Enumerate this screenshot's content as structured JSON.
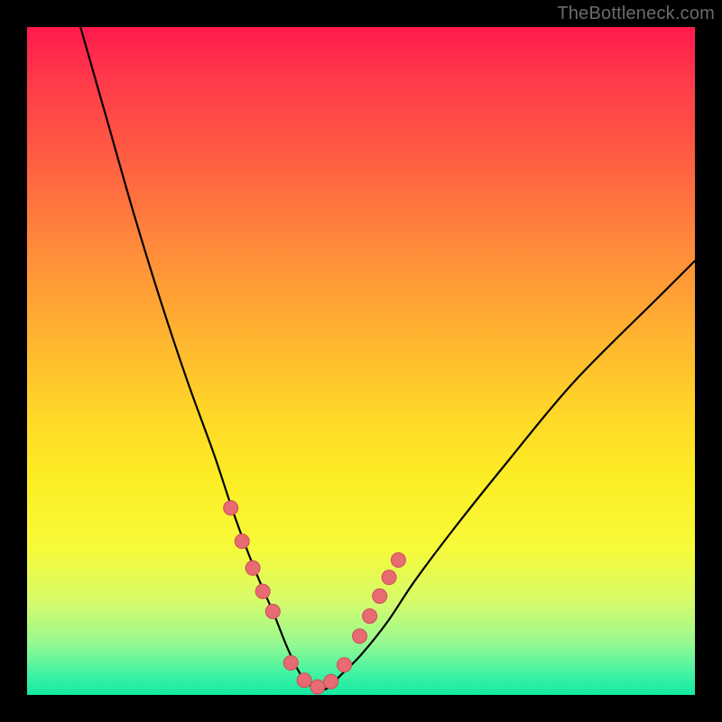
{
  "watermark": "TheBottleneck.com",
  "colors": {
    "frame": "#000000",
    "curve": "#000000",
    "marker_fill": "#e86a73",
    "marker_stroke": "#c84f59",
    "gradient_stops": [
      "#ff1a4d",
      "#ff3a4a",
      "#ff5843",
      "#ff7a3e",
      "#ff9a36",
      "#ffb92f",
      "#ffd728",
      "#fcee25",
      "#f7fa3a",
      "#d6fb6a",
      "#9af98f",
      "#3ef3a4",
      "#12e9a1"
    ]
  },
  "chart_data": {
    "type": "line",
    "title": "",
    "xlabel": "",
    "ylabel": "",
    "xlim": [
      0,
      100
    ],
    "ylim": [
      0,
      100
    ],
    "note": "V-shaped bottleneck curve; y≈mismatch %, minimum near x≈43. Axis values estimated from pixel geometry (no tick labels in source).",
    "series": [
      {
        "name": "bottleneck-curve",
        "x": [
          8,
          12,
          16,
          20,
          24,
          28,
          31,
          34,
          37,
          39,
          41,
          43,
          45,
          47,
          50,
          54,
          58,
          64,
          72,
          82,
          95,
          100
        ],
        "y": [
          100,
          86,
          72,
          59,
          47,
          36,
          27,
          19,
          12,
          7,
          3,
          1,
          1,
          3,
          6,
          11,
          17,
          25,
          35,
          47,
          60,
          65
        ]
      }
    ],
    "markers": {
      "name": "highlight-dots",
      "x": [
        30.5,
        32.2,
        33.8,
        35.3,
        36.8,
        39.5,
        41.5,
        43.5,
        45.5,
        47.5,
        49.8,
        51.3,
        52.8,
        54.2,
        55.6
      ],
      "y": [
        28,
        23,
        19,
        15.5,
        12.5,
        4.8,
        2.2,
        1.2,
        2.0,
        4.5,
        8.8,
        11.8,
        14.8,
        17.6,
        20.2
      ]
    }
  }
}
